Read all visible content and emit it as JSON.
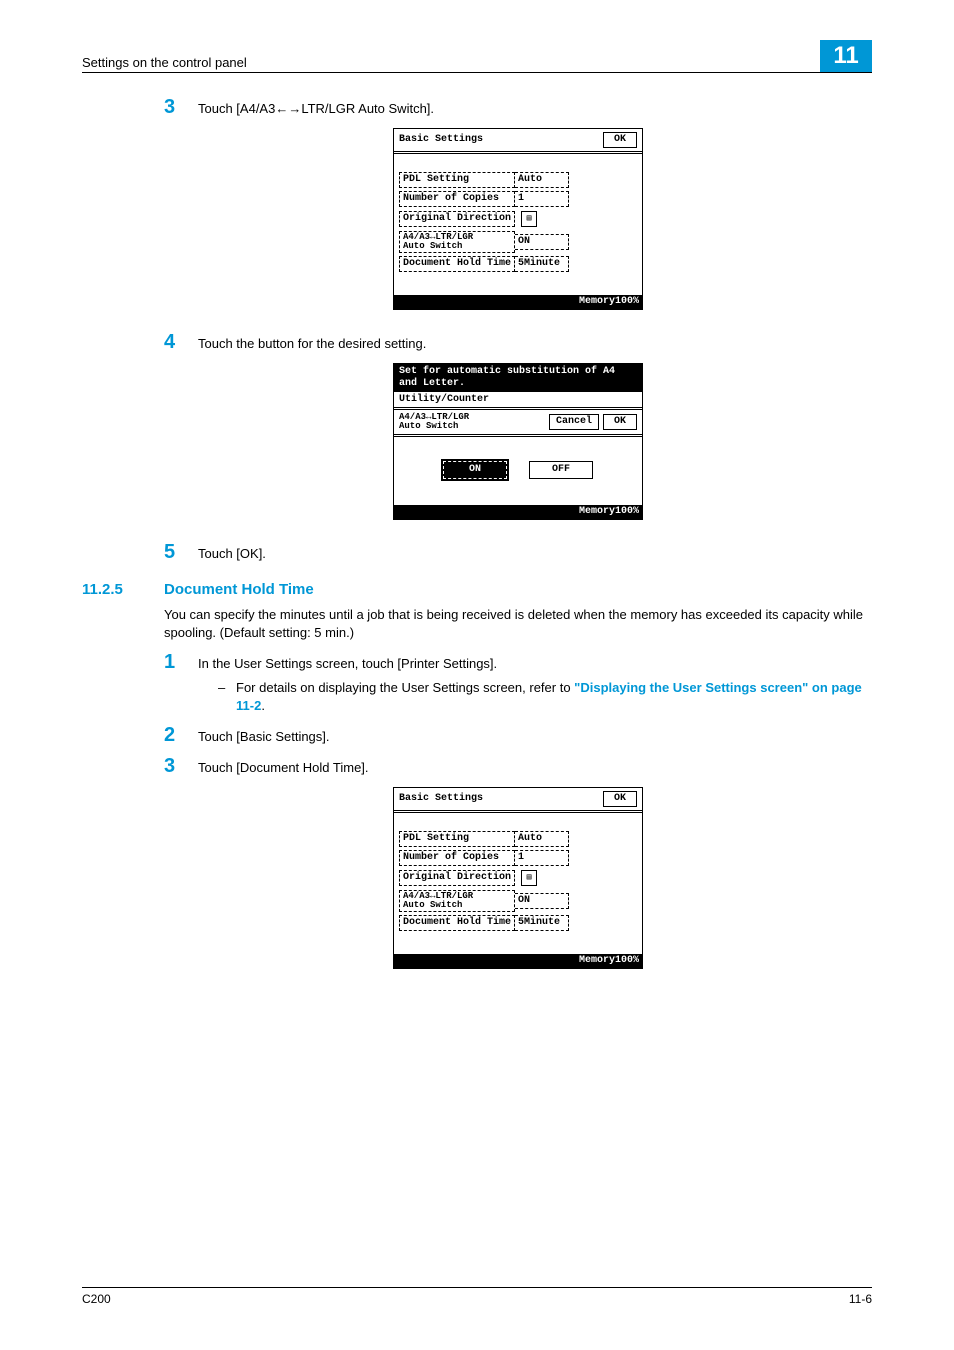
{
  "header": {
    "section_title": "Settings on the control panel",
    "chapter": "11"
  },
  "step3": {
    "num": "3",
    "text": "Touch [A4/A3%%LTR/LGR Auto Switch].",
    "lcd": {
      "title": "Basic Settings",
      "ok": "OK",
      "rows": [
        {
          "label": "PDL Setting",
          "value": "Auto"
        },
        {
          "label": "Number of Copies",
          "value": "1"
        },
        {
          "label": "Original Direction",
          "value": "icon"
        },
        {
          "label_l1": "A4/A3↔LTR/LGR",
          "label_l2": "Auto Switch",
          "value": "ON"
        },
        {
          "label": "Document Hold Time",
          "value": "5Minute"
        }
      ],
      "footer": "Memory100%"
    }
  },
  "step4": {
    "num": "4",
    "text": "Touch the button for the desired setting.",
    "lcd": {
      "msg_l1": "Set for automatic substitution of A4",
      "msg_l2": "and Letter.",
      "crumb": "Utility/Counter",
      "sub_l1": "A4/A3↔LTR/LGR",
      "sub_l2": "Auto Switch",
      "cancel": "Cancel",
      "ok": "OK",
      "opt_on": "ON",
      "opt_off": "OFF",
      "footer": "Memory100%"
    }
  },
  "step5": {
    "num": "5",
    "text": "Touch [OK]."
  },
  "section": {
    "num": "11.2.5",
    "title": "Document Hold Time",
    "para": "You can specify the minutes until a job that is being received is deleted when the memory has exceeded its capacity while spooling. (Default setting: 5 min.)"
  },
  "sub_step1": {
    "num": "1",
    "text": "In the User Settings screen, touch [Printer Settings].",
    "dash": "–",
    "bullet_pre": "For details on displaying the User Settings screen, refer to ",
    "bullet_link": "\"Displaying the User Settings screen\" on page 11-2",
    "bullet_post": "."
  },
  "sub_step2": {
    "num": "2",
    "text": "Touch [Basic Settings]."
  },
  "sub_step3": {
    "num": "3",
    "text": "Touch [Document Hold Time].",
    "lcd": {
      "title": "Basic Settings",
      "ok": "OK",
      "rows": [
        {
          "label": "PDL Setting",
          "value": "Auto"
        },
        {
          "label": "Number of Copies",
          "value": "1"
        },
        {
          "label": "Original Direction",
          "value": "icon"
        },
        {
          "label_l1": "A4/A3↔LTR/LGR",
          "label_l2": "Auto Switch",
          "value": "ON"
        },
        {
          "label": "Document Hold Time",
          "value": "5Minute"
        }
      ],
      "footer": "Memory100%"
    }
  },
  "footer": {
    "left": "C200",
    "right": "11-6"
  }
}
